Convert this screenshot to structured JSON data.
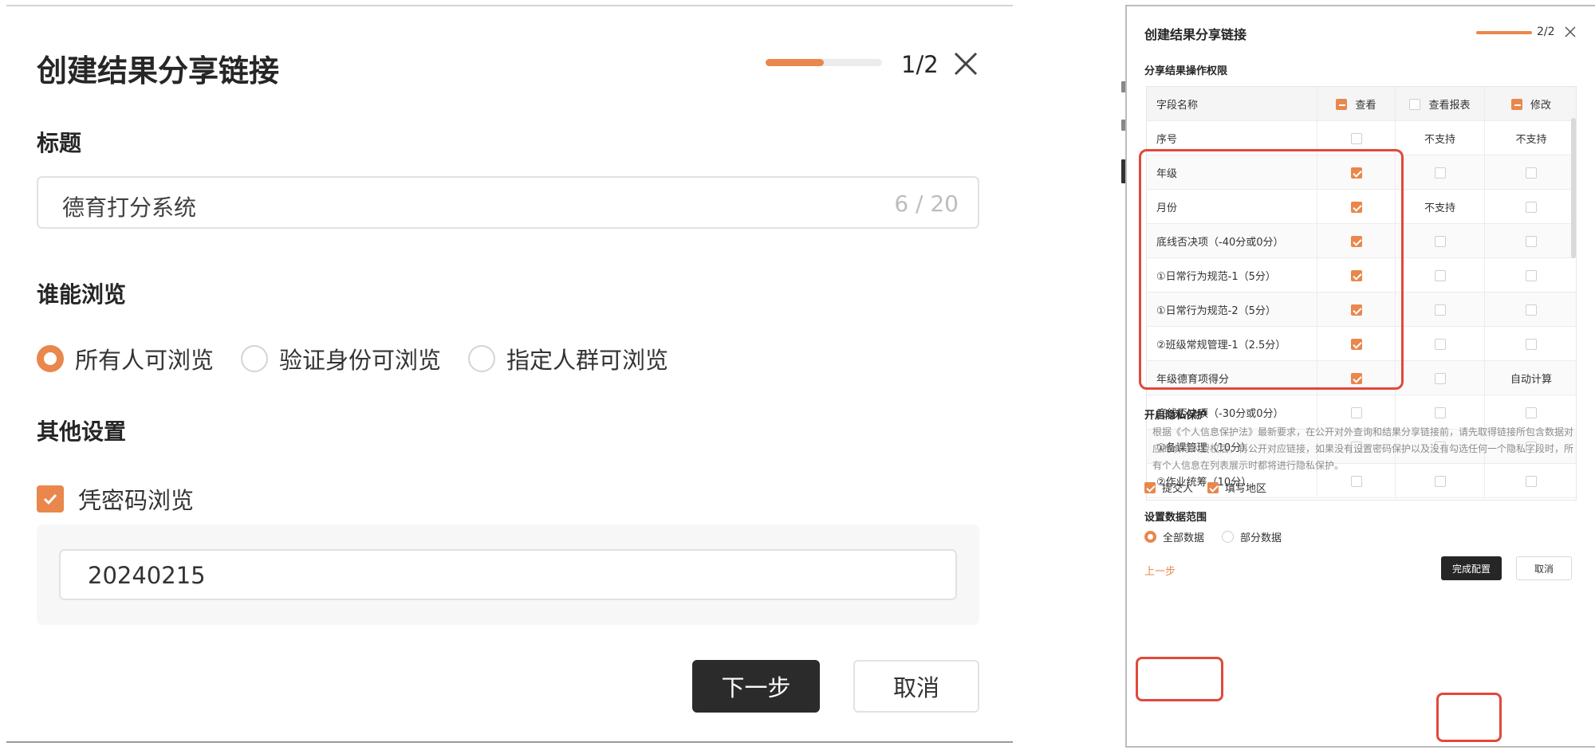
{
  "step1": {
    "title": "创建结果分享链接",
    "progress": 0.5,
    "step_text": "1/2",
    "title_section_label": "标题",
    "title_input_value": "德育打分系统",
    "title_input_count": "6 / 20",
    "browse_section_label": "谁能浏览",
    "browse_options": [
      {
        "label": "所有人可浏览",
        "selected": true
      },
      {
        "label": "验证身份可浏览",
        "selected": false
      },
      {
        "label": "指定人群可浏览",
        "selected": false
      }
    ],
    "other_section_label": "其他设置",
    "password_check_label": "凭密码浏览",
    "password_checked": true,
    "password_value": "20240215",
    "next_label": "下一步",
    "cancel_label": "取消"
  },
  "step2": {
    "title": "创建结果分享链接",
    "step_text": "2/2",
    "perm_section_label": "分享结果操作权限",
    "table_headers": {
      "field": "字段名称",
      "view": "查看",
      "view_report": "查看报表",
      "edit": "修改"
    },
    "rows": [
      {
        "name": "序号",
        "view": "off",
        "report": "不支持",
        "edit": "不支持"
      },
      {
        "name": "年级",
        "view": "on",
        "report": "off",
        "edit": "off"
      },
      {
        "name": "月份",
        "view": "on",
        "report": "不支持",
        "edit": "off"
      },
      {
        "name": "底线否决项（-40分或0分）",
        "view": "on",
        "report": "off",
        "edit": "off"
      },
      {
        "name": "①日常行为规范-1（5分）",
        "view": "on",
        "report": "off",
        "edit": "off"
      },
      {
        "name": "①日常行为规范-2（5分）",
        "view": "on",
        "report": "off",
        "edit": "off"
      },
      {
        "name": "②班级常规管理-1（2.5分）",
        "view": "on",
        "report": "off",
        "edit": "off"
      },
      {
        "name": "年级德育项得分",
        "view": "on",
        "report": "off",
        "edit": "自动计算"
      },
      {
        "name": "底线否决项（-30分或0分）",
        "view": "off",
        "report": "off",
        "edit": "off"
      },
      {
        "name": "①备课管理（10分）",
        "view": "off",
        "report": "off",
        "edit": "off"
      },
      {
        "name": "②作业统筹（10分）",
        "view": "off",
        "report": "off",
        "edit": "off"
      }
    ],
    "privacy_section_label": "开启隐私保护",
    "privacy_text": "根据《个人信息保护法》最新要求，在公开对外查询和结果分享链接前，请先取得链接所包含数据对应的填写人授权后，再公开对应链接，如果没有设置密码保护以及没有勾选任何一个隐私字段时，所有个人信息在列表展示时都将进行隐私保护。",
    "privacy_checks": [
      {
        "label": "提交人",
        "checked": true
      },
      {
        "label": "填写地区",
        "checked": true
      }
    ],
    "range_section_label": "设置数据范围",
    "range_options": [
      {
        "label": "全部数据",
        "selected": true
      },
      {
        "label": "部分数据",
        "selected": false
      }
    ],
    "prev_label": "上一步",
    "done_label": "完成配置",
    "cancel_label": "取消"
  },
  "colors": {
    "accent": "#e9874c",
    "highlight": "#e0493b",
    "dark_button": "#2b2b2b"
  }
}
